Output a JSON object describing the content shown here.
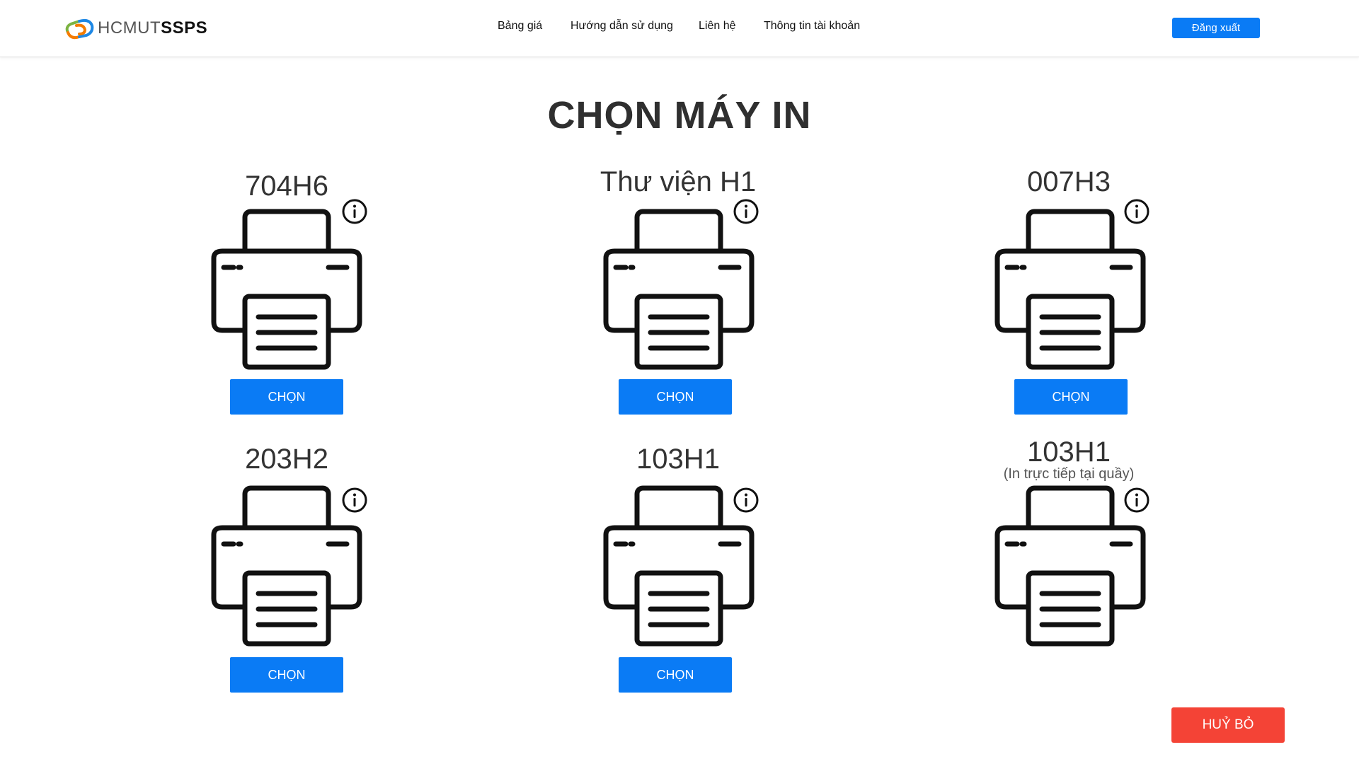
{
  "header": {
    "logo_light": "HCMUT",
    "logo_bold": "SSPS",
    "nav": [
      {
        "label": "Bảng giá"
      },
      {
        "label": "Hướng dẫn sử dụng"
      },
      {
        "label": "Liên hệ"
      },
      {
        "label": "Thông tin tài khoản"
      }
    ],
    "logout_label": "Đăng xuất"
  },
  "main": {
    "title": "CHỌN MÁY IN",
    "printers": [
      {
        "name": "704H6",
        "subtitle": "",
        "button": "CHỌN"
      },
      {
        "name": "Thư viện H1",
        "subtitle": "",
        "button": "CHỌN"
      },
      {
        "name": "007H3",
        "subtitle": "",
        "button": "CHỌN"
      },
      {
        "name": "203H2",
        "subtitle": "",
        "button": "CHỌN"
      },
      {
        "name": "103H1",
        "subtitle": "",
        "button": "CHỌN"
      },
      {
        "name": "103H1",
        "subtitle": "(In trực tiếp tại quầy)",
        "button": ""
      }
    ],
    "cancel_label": "HUỶ BỎ"
  },
  "colors": {
    "primary": "#0a7bf5",
    "danger": "#f44336",
    "logo_blue": "#1e88e5",
    "logo_orange": "#f57c00",
    "logo_green": "#7cb342"
  },
  "icons": {
    "printer": "printer-icon",
    "info": "info-icon"
  }
}
